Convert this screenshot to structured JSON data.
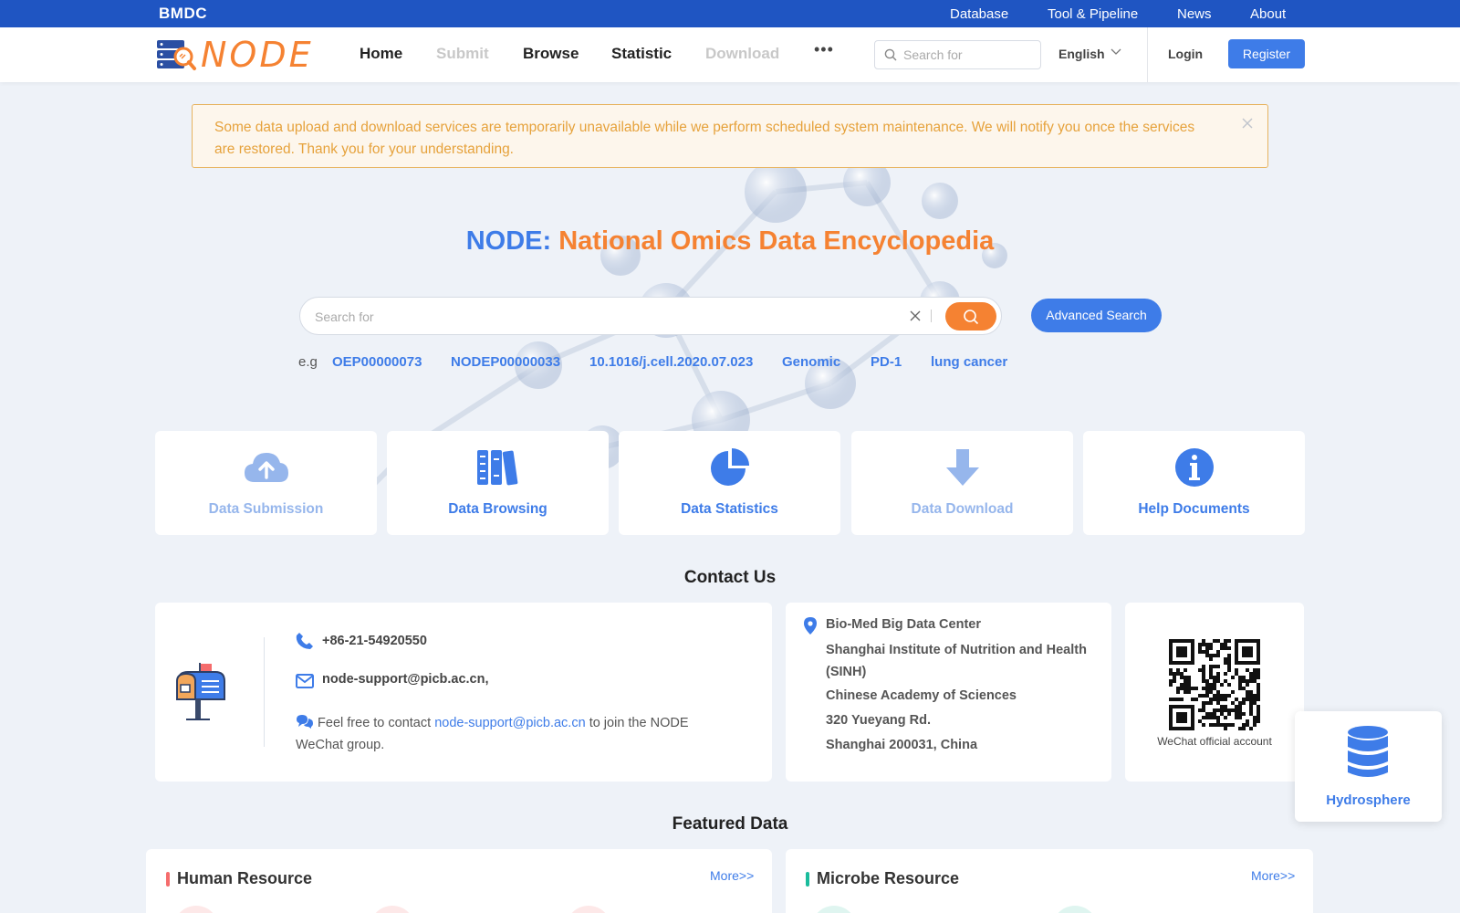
{
  "topbar": {
    "brand": "BMDC",
    "links": [
      "Database",
      "Tool & Pipeline",
      "News",
      "About"
    ]
  },
  "header": {
    "logo_text": "NODE",
    "nav": [
      {
        "label": "Home",
        "enabled": true
      },
      {
        "label": "Submit",
        "enabled": false
      },
      {
        "label": "Browse",
        "enabled": true
      },
      {
        "label": "Statistic",
        "enabled": true
      },
      {
        "label": "Download",
        "enabled": false
      }
    ],
    "more": "•••",
    "search_placeholder": "Search for",
    "language": "English",
    "login": "Login",
    "register": "Register"
  },
  "alert": {
    "message": "Some data upload and download services are temporarily unavailable while we perform scheduled system maintenance. We will notify you once the services are restored. Thank you for your understanding."
  },
  "hero": {
    "title_prefix": "NODE:",
    "title_main": "National Omics Data Encyclopedia",
    "search_placeholder": "Search for",
    "advanced_search": "Advanced Search",
    "examples_label": "e.g",
    "examples": [
      "OEP00000073",
      "NODEP00000033",
      "10.1016/j.cell.2020.07.023",
      "Genomic",
      "PD-1",
      "lung cancer"
    ]
  },
  "features": [
    {
      "label": "Data Submission",
      "icon": "cloud-upload-icon",
      "enabled": false
    },
    {
      "label": "Data Browsing",
      "icon": "books-icon",
      "enabled": true
    },
    {
      "label": "Data Statistics",
      "icon": "pie-chart-icon",
      "enabled": true
    },
    {
      "label": "Data Download",
      "icon": "download-arrow-icon",
      "enabled": false
    },
    {
      "label": "Help Documents",
      "icon": "info-icon",
      "enabled": true
    }
  ],
  "contact": {
    "title": "Contact Us",
    "phone": "+86-21-54920550",
    "email": "node-support@picb.ac.cn,",
    "wechat_prefix": "Feel free to contact",
    "wechat_email": "node-support@picb.ac.cn",
    "wechat_suffix": "to join the NODE WeChat group.",
    "address": [
      "Bio-Med Big Data Center",
      "Shanghai Institute of Nutrition and Health (SINH)",
      "Chinese Academy of Sciences",
      "320 Yueyang Rd.",
      "Shanghai 200031, China"
    ],
    "qr_caption": "WeChat official account"
  },
  "hydrosphere": {
    "label": "Hydrosphere"
  },
  "featured": {
    "title": "Featured Data",
    "human": {
      "title": "Human Resource",
      "more": "More>>"
    },
    "microbe": {
      "title": "Microbe Resource",
      "more": "More>>"
    }
  },
  "colors": {
    "primary": "#3e7ce8",
    "accent": "#f58232",
    "topbar": "#1f55c2",
    "alert_text": "#e6a23c",
    "human_bar": "#f56c6c",
    "microbe_bar": "#1abc9c"
  }
}
